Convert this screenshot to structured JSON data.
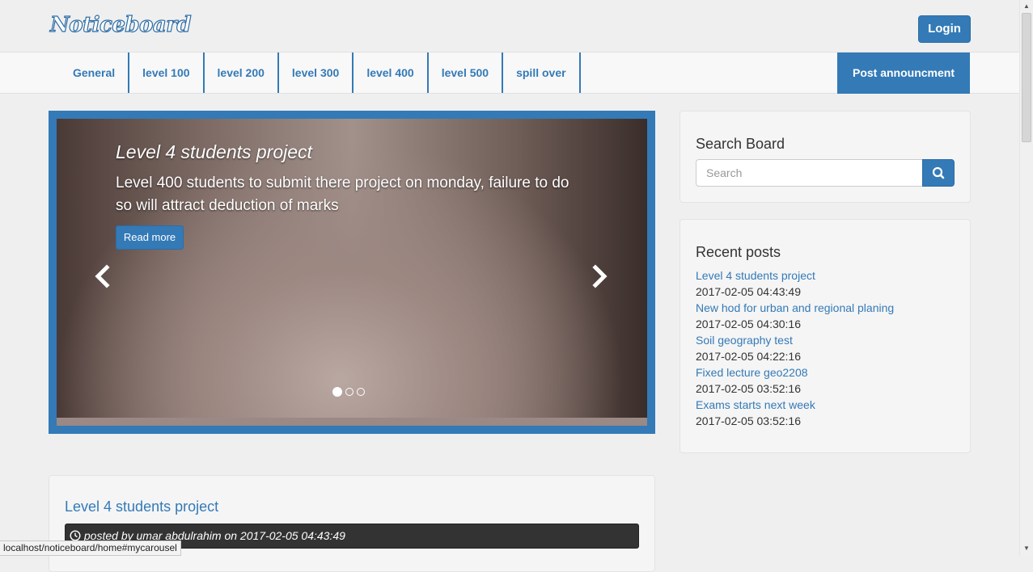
{
  "header": {
    "logo_text": "Noticeboard",
    "login_label": "Login"
  },
  "nav": {
    "items": [
      "General",
      "level 100",
      "level 200",
      "level 300",
      "level 400",
      "level 500",
      "spill over"
    ],
    "post_label": "Post announcment"
  },
  "carousel": {
    "slide_title": "Level 4 students project",
    "slide_text": "Level 400 students to submit there project on monday, failure to do so will attract deduction of marks",
    "read_more_label": "Read more",
    "prev_icon": "chevron-left-icon",
    "next_icon": "chevron-right-icon",
    "slide_count": 3,
    "active_index": 0
  },
  "search": {
    "heading": "Search Board",
    "placeholder": "Search",
    "icon": "search-icon"
  },
  "recent": {
    "heading": "Recent posts",
    "posts": [
      {
        "title": "Level 4 students project",
        "date": "2017-02-05 04:43:49"
      },
      {
        "title": "New hod for urban and regional planing",
        "date": "2017-02-05 04:30:16"
      },
      {
        "title": "Soil geography test",
        "date": "2017-02-05 04:22:16"
      },
      {
        "title": "Fixed lecture geo2208",
        "date": "2017-02-05 03:52:16"
      },
      {
        "title": "Exams starts next week",
        "date": "2017-02-05 03:52:16"
      }
    ]
  },
  "post": {
    "title": "Level 4 students project",
    "meta_prefix": "posted by ",
    "author": "umar abdulrahim",
    "meta_on": " on ",
    "date": "2017-02-05 04:43:49",
    "icon": "clock-icon"
  },
  "status_bar": {
    "url": "localhost/noticeboard/home#mycarousel"
  },
  "colors": {
    "primary": "#337ab7",
    "background": "#efefef",
    "panel": "#f5f5f5",
    "meta_bar": "#333333"
  }
}
